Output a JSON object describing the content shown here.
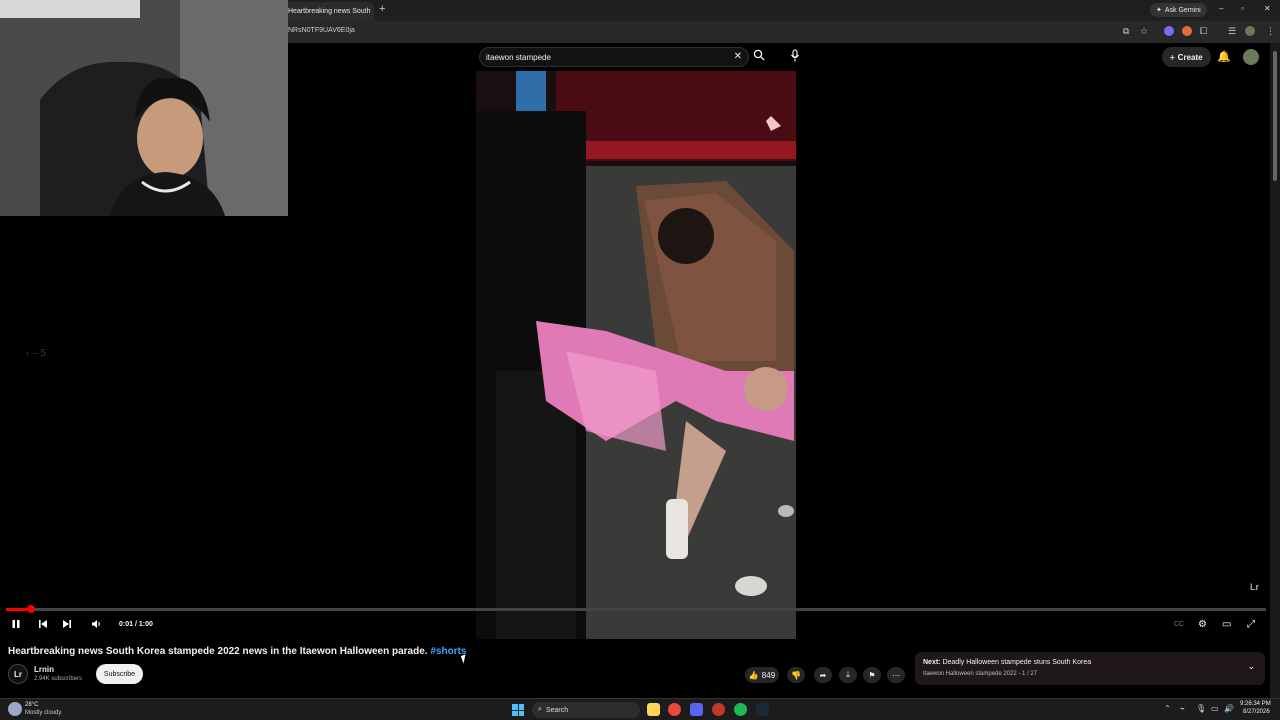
{
  "browser": {
    "tab_title": "Heartbreaking news South",
    "new_tab": "+",
    "ask_gemini": "Ask Gemini",
    "url_fragment": "NRsN0TF9UAV6E0ja",
    "window_controls": [
      "–",
      "▫",
      "✕"
    ]
  },
  "youtube": {
    "search_value": "itaewon stampede",
    "create_label": "Create",
    "prev_nav": "‹ – 5",
    "overlay_badge": "Lr"
  },
  "player": {
    "progress_fraction": 0.02,
    "time": "0:01 / 1:00"
  },
  "video": {
    "title": "Heartbreaking news South Korea stampede 2022 news in the Itaewon Halloween parade. ",
    "hashtag": "#shorts"
  },
  "channel": {
    "avatar_text": "Lr",
    "name": "Lrnin",
    "subscribers": "2.94K subscribers",
    "subscribe_label": "Subscribe"
  },
  "actions": {
    "like_count": "849"
  },
  "up_next": {
    "prefix": "Next:",
    "title": " Deadly Halloween stampede stuns South Korea",
    "playlist": "Itaewon Halloween stampede 2022 - 1 / 27"
  },
  "taskbar": {
    "temperature": "28°C",
    "weather": "Mostly cloudy",
    "search_label": "Search",
    "time": "9:26:34 PM",
    "date": "8/27/2026"
  },
  "colors": {
    "progress": "#ff0000",
    "hashtag": "#3ea6ff",
    "windows_accent": "#4cc2ff"
  }
}
